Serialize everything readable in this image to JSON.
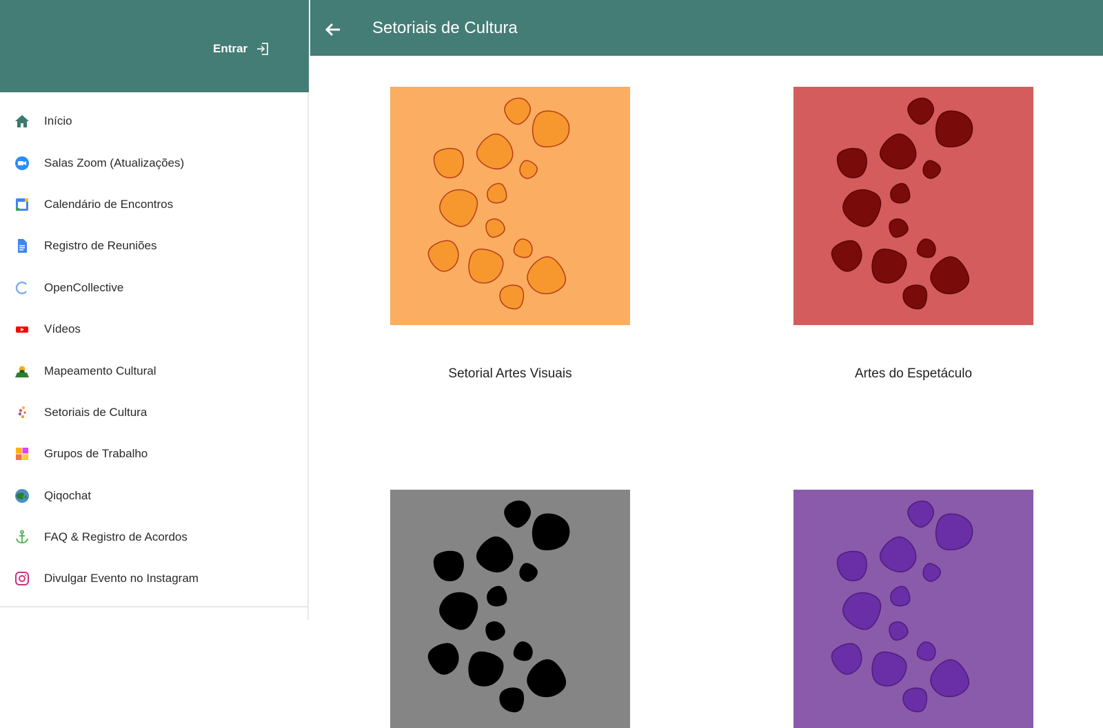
{
  "drawer": {
    "login_label": "Entrar",
    "items": [
      {
        "label": "Início",
        "icon": "home-icon"
      },
      {
        "label": "Salas Zoom (Atualizações)",
        "icon": "zoom-icon"
      },
      {
        "label": "Calendário de Encontros",
        "icon": "calendar-icon"
      },
      {
        "label": "Registro de Reuniões",
        "icon": "document-icon"
      },
      {
        "label": "OpenCollective",
        "icon": "opencollective-icon"
      },
      {
        "label": "Vídeos",
        "icon": "video-icon"
      },
      {
        "label": "Mapeamento Cultural",
        "icon": "map-person-icon"
      },
      {
        "label": "Setoriais de Cultura",
        "icon": "setoriais-icon"
      },
      {
        "label": "Grupos de Trabalho",
        "icon": "groups-icon"
      },
      {
        "label": "Qiqochat",
        "icon": "globe-icon"
      },
      {
        "label": "FAQ & Registro de Acordos",
        "icon": "anchor-icon"
      },
      {
        "label": "Divulgar Evento no Instagram",
        "icon": "instagram-icon"
      }
    ]
  },
  "appbar": {
    "title": "Setoriais de Cultura"
  },
  "cards": [
    {
      "label": "Setorial Artes Visuais",
      "bg": "#fbad62",
      "blob": "#f7982f",
      "stroke": "#b53d18"
    },
    {
      "label": "Artes do Espetáculo",
      "bg": "#d55c5c",
      "blob": "#7a0b0b",
      "stroke": "#5a0505"
    },
    {
      "label": "",
      "bg": "#858585",
      "blob": "#000000",
      "stroke": "#000000"
    },
    {
      "label": "",
      "bg": "#8a5aab",
      "blob": "#6a2ea6",
      "stroke": "#4d1d7e"
    }
  ],
  "colors": {
    "primary": "#447d75"
  }
}
